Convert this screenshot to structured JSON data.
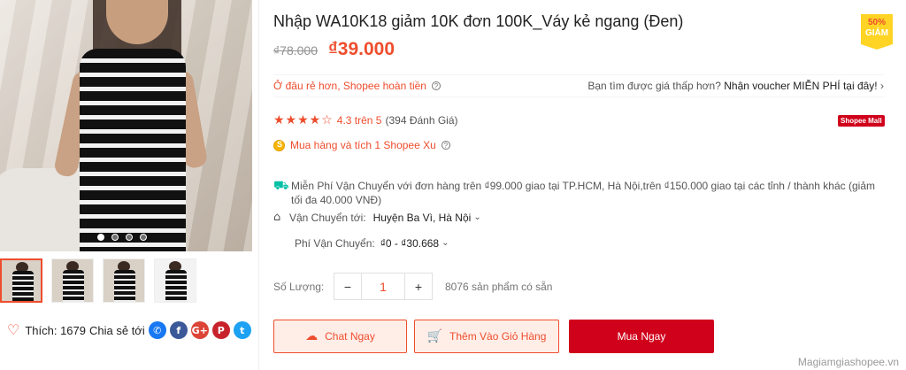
{
  "product": {
    "title": "Nhập WA10K18 giảm 10K đơn 100K_Váy kẻ ngang (Đen)",
    "old_price": "₫78.000",
    "new_price": "₫39.000",
    "badge_percent": "50%",
    "badge_label": "GIẢM"
  },
  "gallery": {
    "dot_count": 4,
    "active_dot": 0,
    "thumb_count": 4
  },
  "social": {
    "like_label": "Thích: 1679",
    "share_label": "Chia sẻ tới",
    "icons": [
      {
        "name": "messenger-icon",
        "glyph": "✆",
        "color": "#1877f2"
      },
      {
        "name": "facebook-icon",
        "glyph": "f",
        "color": "#3b5998"
      },
      {
        "name": "google-plus-icon",
        "glyph": "G+",
        "color": "#db4437"
      },
      {
        "name": "pinterest-icon",
        "glyph": "P",
        "color": "#c8232c"
      },
      {
        "name": "twitter-icon",
        "glyph": "t",
        "color": "#1da1f2"
      }
    ]
  },
  "refund": {
    "left_text": "Ở đâu rẻ hơn, Shopee hoàn tiền",
    "right_prefix": "Bạn tìm được giá thấp hơn?",
    "right_link": "Nhận voucher MIỄN PHÍ tại đây!",
    "right_chevron": "›"
  },
  "rating": {
    "stars": "★★★★☆",
    "score": "4.3 trên 5",
    "count": "(394 Đánh Giá)",
    "value": 4.3,
    "mall_label": "Shopee Mall"
  },
  "xu": {
    "text": "Mua hàng và tích 1 Shopee Xu"
  },
  "shipping": {
    "free_text": "Miễn Phí Vận Chuyển với đơn hàng trên ₫99.000 giao tại TP.HCM, Hà Nội,trên ₫150.000 giao tại các tỉnh / thành khác (giảm tối đa 40.000 VNĐ)",
    "to_label": "Vận Chuyển tới:",
    "to_value": "Huyện Ba Vì, Hà Nội",
    "fee_label": "Phí Vận Chuyển:",
    "fee_value": "₫0 - ₫30.668"
  },
  "quantity": {
    "label": "Số Lượng:",
    "minus": "−",
    "value": "1",
    "plus": "+",
    "stock": "8076 sản phẩm có sẵn"
  },
  "actions": {
    "chat": "Chat Ngay",
    "add_cart": "Thêm Vào Giỏ Hàng",
    "buy": "Mua Ngay"
  },
  "watermark": "Magiamgiashopee.vn",
  "colors": {
    "accent": "#ee4d2d",
    "buy": "#d0011b",
    "badge": "#ffd424"
  }
}
